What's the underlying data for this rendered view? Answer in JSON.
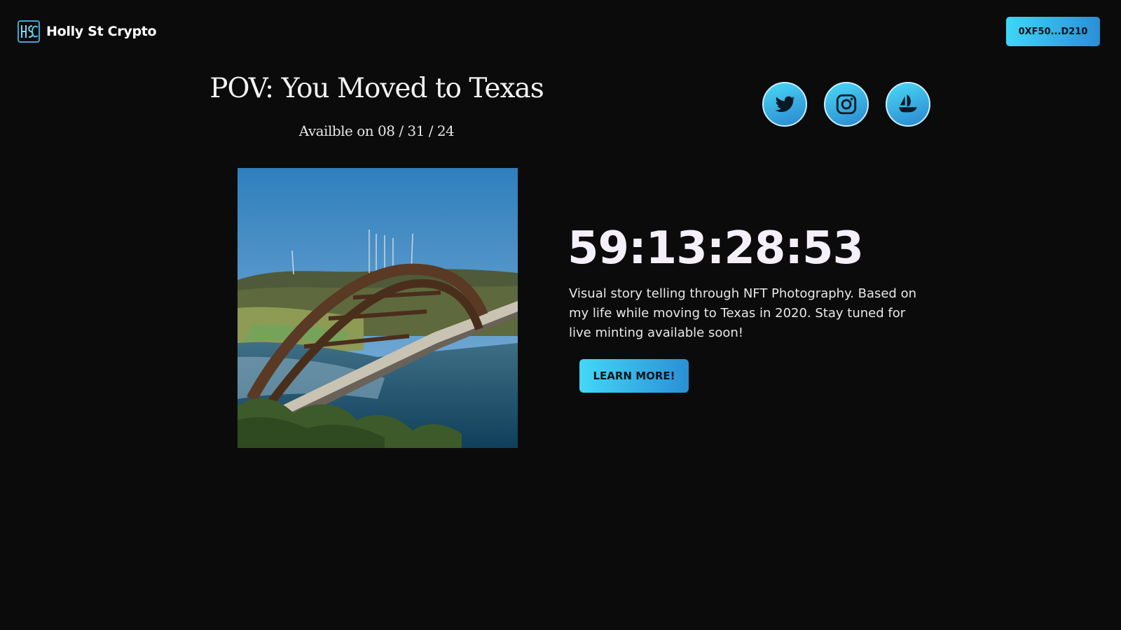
{
  "header": {
    "brand_name": "Holly St Crypto",
    "wallet_label": "0XF50...D210",
    "logo_icon": "hsc-logo-icon"
  },
  "hero": {
    "title": "POV: You Moved to Texas",
    "subtitle": "Availble on 08 / 31 / 24",
    "countdown": "59:13:28:53",
    "description": "Visual story telling through NFT Photography. Based on my life while moving to Texas in 2020. Stay tuned for live minting available soon!",
    "cta_label": "LEARN MORE!",
    "image_icon": "bridge-photo"
  },
  "socials": [
    {
      "icon": "twitter-icon"
    },
    {
      "icon": "instagram-icon"
    },
    {
      "icon": "opensea-icon"
    }
  ],
  "colors": {
    "background": "#0b0b0c",
    "accent_start": "#3fd6f5",
    "accent_end": "#2a8fd6",
    "text": "#ffffff"
  }
}
